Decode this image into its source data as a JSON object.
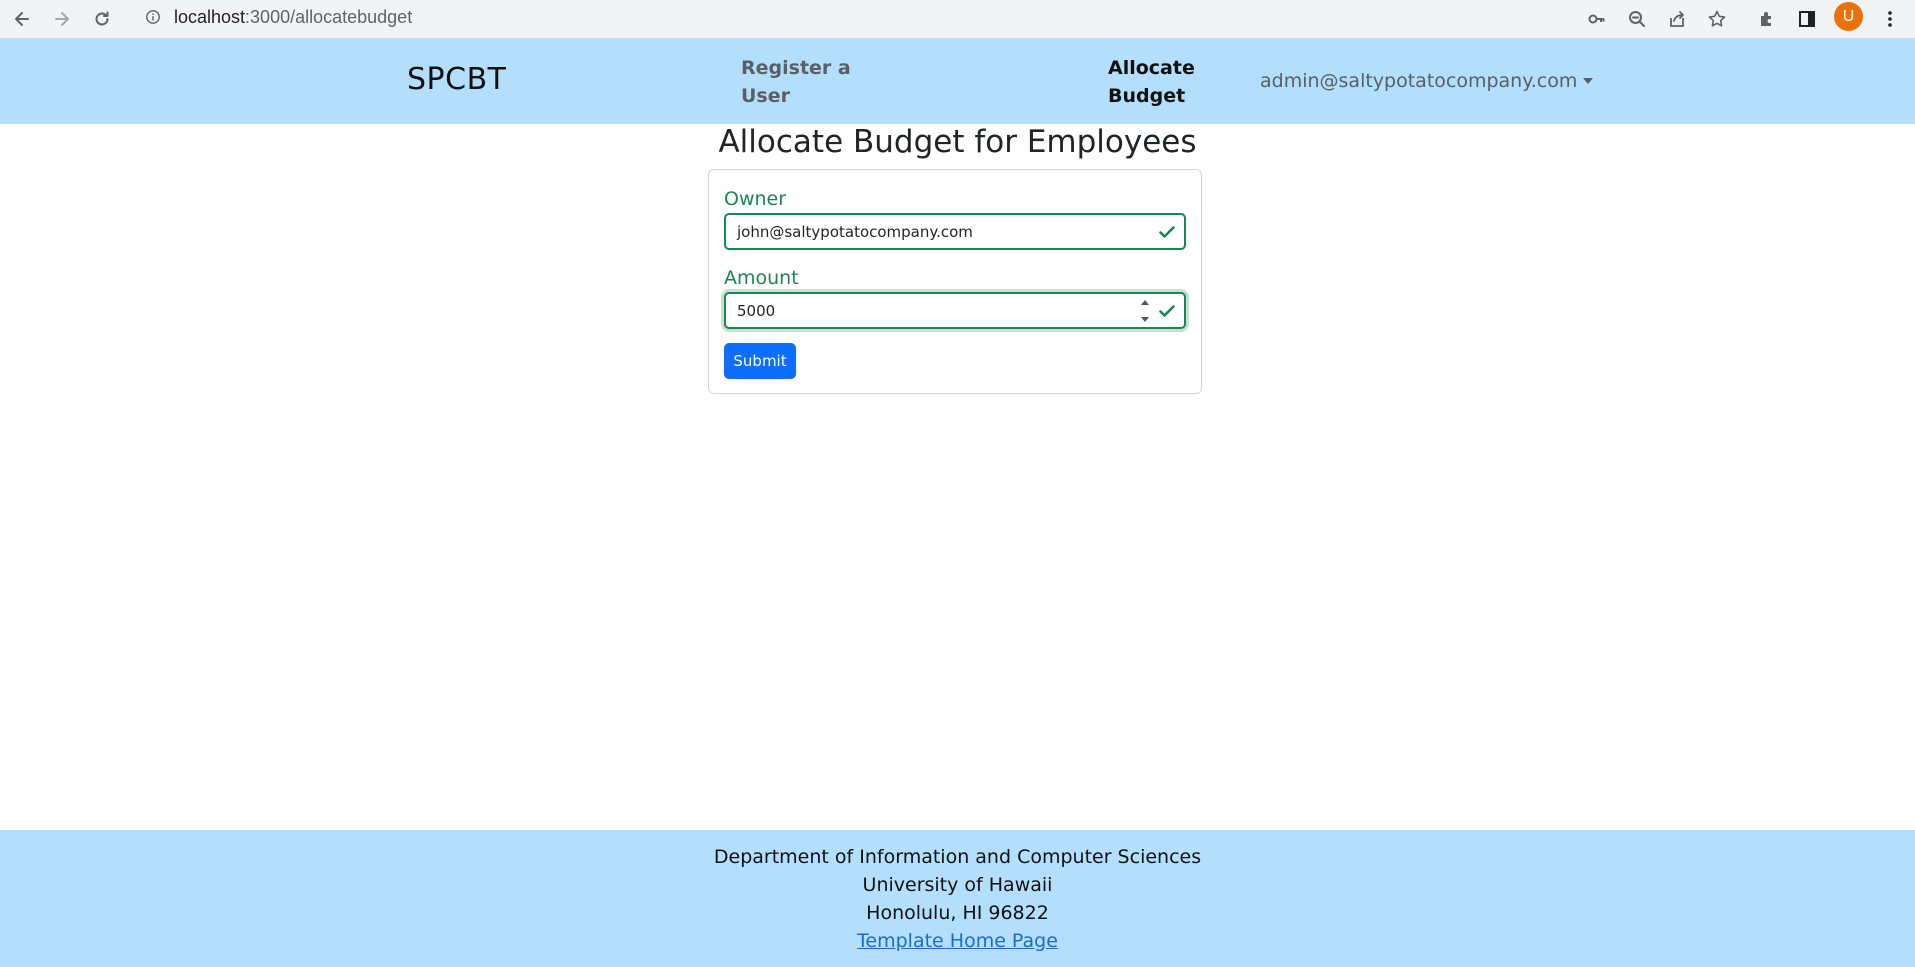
{
  "browser": {
    "url_host": "localhost",
    "url_path": ":3000/allocatebudget",
    "profile_initial": "U",
    "icons": [
      "back-icon",
      "forward-icon",
      "reload-icon",
      "info-icon",
      "key-icon",
      "zoom-icon",
      "share-icon",
      "star-icon",
      "extensions-icon",
      "sidepanel-icon",
      "menu-icon"
    ]
  },
  "navbar": {
    "brand": "SPCBT",
    "links": [
      {
        "label_line1": "Register a",
        "label_line2": "User"
      },
      {
        "label_line1": "Allocate",
        "label_line2": "Budget"
      }
    ],
    "user_email": "admin@saltypotatocompany.com"
  },
  "main": {
    "title": "Allocate Budget for Employees",
    "form": {
      "owner_label": "Owner",
      "owner_value": "john@saltypotatocompany.com",
      "amount_label": "Amount",
      "amount_value": "5000",
      "submit_label": "Submit"
    }
  },
  "footer": {
    "line1": "Department of Information and Computer Sciences",
    "line2": "University of Hawaii",
    "line3": "Honolulu, HI 96822",
    "link_text": "Template Home Page"
  },
  "colors": {
    "navbar_bg": "#b3dffc",
    "valid_green": "#198754",
    "primary_blue": "#0d6efd"
  }
}
